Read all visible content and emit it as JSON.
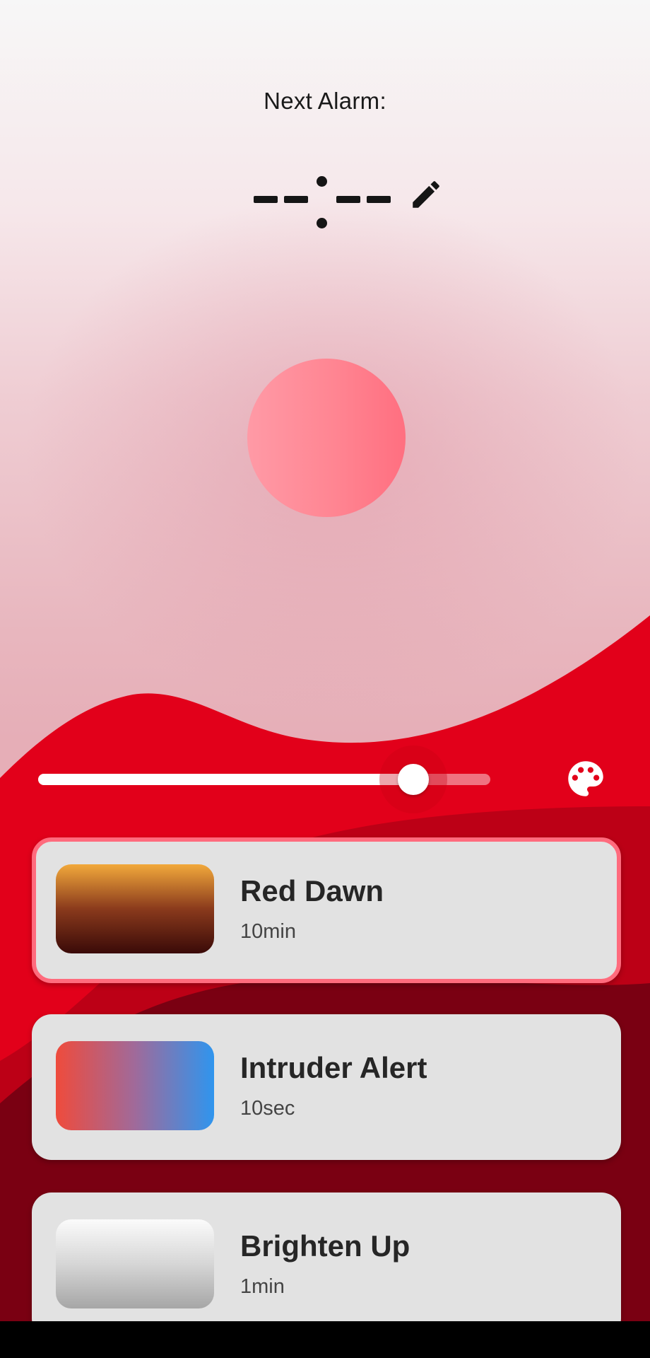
{
  "header": {
    "next_alarm_label": "Next Alarm:",
    "time_value": "--:--",
    "edit_icon": "pencil-icon"
  },
  "controls": {
    "brightness_level": 0.83,
    "palette_icon": "palette-icon"
  },
  "presets": [
    {
      "name": "Red Dawn",
      "duration": "10min",
      "selected": true,
      "gradient": [
        "#f2a93b",
        "#8a3a1c",
        "#3a0a08"
      ]
    },
    {
      "name": "Intruder Alert",
      "duration": "10sec",
      "selected": false,
      "gradient": [
        "#ef4b3c",
        "#a06a9a",
        "#2f95ee"
      ]
    },
    {
      "name": "Brighten Up",
      "duration": "1min",
      "selected": false,
      "gradient": [
        "#fbfbfb",
        "#d6d6d6",
        "#a6a6a6"
      ]
    }
  ],
  "colors": {
    "accent_red": "#e2001a",
    "orb": "#ff8592",
    "selected_border": "#ff6b7d"
  }
}
